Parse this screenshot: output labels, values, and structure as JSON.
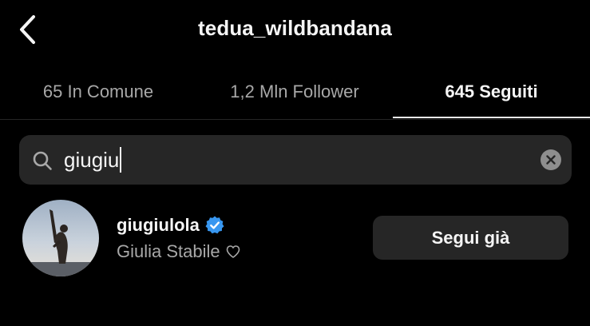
{
  "header": {
    "title": "tedua_wildbandana"
  },
  "tabs": [
    {
      "label": "65 In Comune",
      "active": false
    },
    {
      "label": "1,2 Mln Follower",
      "active": false
    },
    {
      "label": "645 Seguiti",
      "active": true
    }
  ],
  "search": {
    "value": "giugiu"
  },
  "results": [
    {
      "username": "giugiulola",
      "verified": true,
      "full_name": "Giulia Stabile",
      "button_label": "Segui già"
    }
  ],
  "colors": {
    "background": "#000000",
    "surface": "#262626",
    "text_primary": "#f5f5f5",
    "text_secondary": "#a8a8a8",
    "verified_badge": "#3897f0"
  },
  "icons": {
    "back": "chevron-left-icon",
    "search": "search-icon",
    "clear": "clear-icon",
    "verified": "verified-badge-icon",
    "heart": "heart-icon"
  }
}
